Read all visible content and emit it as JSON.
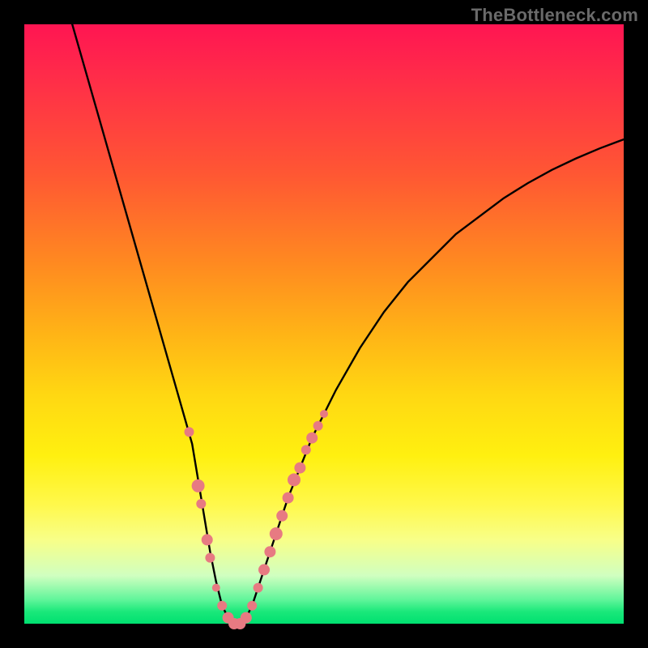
{
  "watermark": "TheBottleneck.com",
  "chart_data": {
    "type": "line",
    "title": "",
    "xlabel": "",
    "ylabel": "",
    "xlim": [
      0,
      100
    ],
    "ylim": [
      0,
      100
    ],
    "series": [
      {
        "name": "bottleneck-curve",
        "x": [
          8,
          10,
          12,
          14,
          16,
          18,
          20,
          22,
          24,
          26,
          28,
          30,
          31,
          32,
          33,
          34,
          35,
          36,
          37,
          38,
          40,
          42,
          44,
          46,
          48,
          52,
          56,
          60,
          64,
          68,
          72,
          76,
          80,
          84,
          88,
          92,
          96,
          100
        ],
        "y": [
          100,
          93,
          86,
          79,
          72,
          65,
          58,
          51,
          44,
          37,
          30,
          18,
          12,
          7,
          3,
          1,
          0,
          0,
          1,
          3,
          9,
          15,
          21,
          26,
          31,
          39,
          46,
          52,
          57,
          61,
          65,
          68,
          71,
          73.5,
          75.7,
          77.6,
          79.3,
          80.8
        ]
      }
    ],
    "markers": {
      "name": "data-points",
      "color": "#e77a82",
      "points": [
        {
          "x": 27.5,
          "y": 32,
          "r": 6
        },
        {
          "x": 29,
          "y": 23,
          "r": 8
        },
        {
          "x": 29.5,
          "y": 20,
          "r": 6
        },
        {
          "x": 30.5,
          "y": 14,
          "r": 7
        },
        {
          "x": 31,
          "y": 11,
          "r": 6
        },
        {
          "x": 32,
          "y": 6,
          "r": 5
        },
        {
          "x": 33,
          "y": 3,
          "r": 6
        },
        {
          "x": 34,
          "y": 1,
          "r": 7
        },
        {
          "x": 35,
          "y": 0,
          "r": 7
        },
        {
          "x": 36,
          "y": 0,
          "r": 7
        },
        {
          "x": 37,
          "y": 1,
          "r": 7
        },
        {
          "x": 38,
          "y": 3,
          "r": 6
        },
        {
          "x": 39,
          "y": 6,
          "r": 6
        },
        {
          "x": 40,
          "y": 9,
          "r": 7
        },
        {
          "x": 41,
          "y": 12,
          "r": 7
        },
        {
          "x": 42,
          "y": 15,
          "r": 8
        },
        {
          "x": 43,
          "y": 18,
          "r": 7
        },
        {
          "x": 44,
          "y": 21,
          "r": 7
        },
        {
          "x": 45,
          "y": 24,
          "r": 8
        },
        {
          "x": 46,
          "y": 26,
          "r": 7
        },
        {
          "x": 47,
          "y": 29,
          "r": 6
        },
        {
          "x": 48,
          "y": 31,
          "r": 7
        },
        {
          "x": 49,
          "y": 33,
          "r": 6
        },
        {
          "x": 50,
          "y": 35,
          "r": 5
        }
      ]
    },
    "background_gradient": {
      "top": "#ff1552",
      "middle": "#fff010",
      "bottom": "#00e070"
    }
  }
}
